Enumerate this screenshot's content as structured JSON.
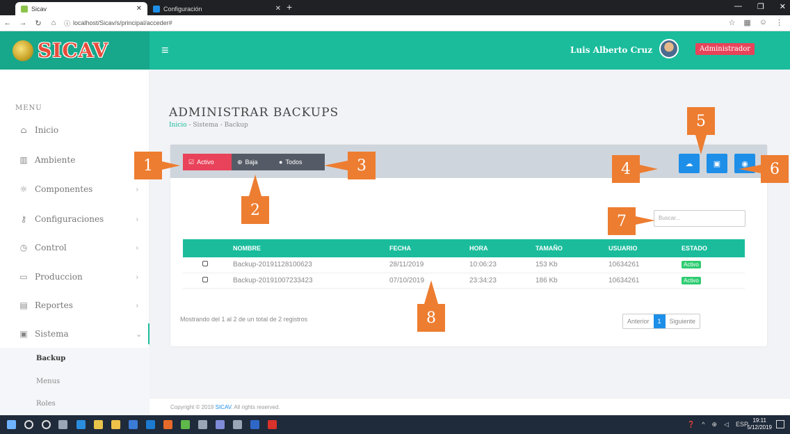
{
  "browser": {
    "tabs": [
      {
        "label": "Sicav"
      },
      {
        "label": "Configuración"
      }
    ],
    "url": "localhost/Sicav/s/principal/acceder#"
  },
  "header": {
    "brand": "SICAV",
    "user_name": "Luis Alberto Cruz",
    "role": "Administrador"
  },
  "sidebar": {
    "menu_heading": "MENU",
    "items": [
      {
        "label": "Inicio",
        "icon": "home-icon"
      },
      {
        "label": "Ambiente",
        "icon": "bank-icon"
      },
      {
        "label": "Componentes",
        "icon": "gear-icon"
      },
      {
        "label": "Configuraciones",
        "icon": "key-icon"
      },
      {
        "label": "Control",
        "icon": "clock-icon"
      },
      {
        "label": "Produccion",
        "icon": "box-icon"
      },
      {
        "label": "Reportes",
        "icon": "chart-icon"
      },
      {
        "label": "Sistema",
        "icon": "window-icon"
      }
    ],
    "sub_items": [
      "Backup",
      "Menus",
      "Roles"
    ]
  },
  "page": {
    "title": "ADMINISTRAR BACKUPS",
    "breadcrumb": {
      "home": "Inicio",
      "rest": " - Sistema - Backup"
    }
  },
  "toolbar": {
    "filters": [
      {
        "label": "Activo",
        "icon": "☑"
      },
      {
        "label": "Baja",
        "icon": "⊕"
      },
      {
        "label": "Todos",
        "icon": "●"
      }
    ],
    "actions": [
      {
        "icon": "cloud-upload-icon",
        "glyph": "☁"
      },
      {
        "icon": "save-icon",
        "glyph": "▣"
      },
      {
        "icon": "eye-icon",
        "glyph": "◉"
      }
    ]
  },
  "search": {
    "placeholder": "Buscar..."
  },
  "table": {
    "columns": [
      "",
      "NOMBRE",
      "FECHA",
      "HORA",
      "TAMAÑO",
      "USUARIO",
      "ESTADO"
    ],
    "rows": [
      {
        "nombre": "Backup-20191128100623",
        "fecha": "28/11/2019",
        "hora": "10:06:23",
        "tamano": "153 Kb",
        "usuario": "10634261",
        "estado": "Activo"
      },
      {
        "nombre": "Backup-20191007233423",
        "fecha": "07/10/2019",
        "hora": "23:34:23",
        "tamano": "186 Kb",
        "usuario": "10634261",
        "estado": "Activo"
      }
    ]
  },
  "pagination": {
    "info": "Mostrando del 1 al 2 de un total de 2 registros",
    "prev": "Anterior",
    "current": "1",
    "next": "Siguiente"
  },
  "footer": {
    "prefix": "Copyright © 2019 ",
    "brand": "SICAV",
    "suffix": ". All rights reserved."
  },
  "taskbar": {
    "lang": "ESP",
    "time": "19:11",
    "date": "5/12/2019"
  },
  "callouts": [
    "1",
    "2",
    "3",
    "4",
    "5",
    "6",
    "7",
    "8"
  ],
  "colors": {
    "teal": "#1abc9c",
    "red": "#e8435a",
    "blue": "#1e8fe8",
    "callout": "#ed7d31"
  }
}
